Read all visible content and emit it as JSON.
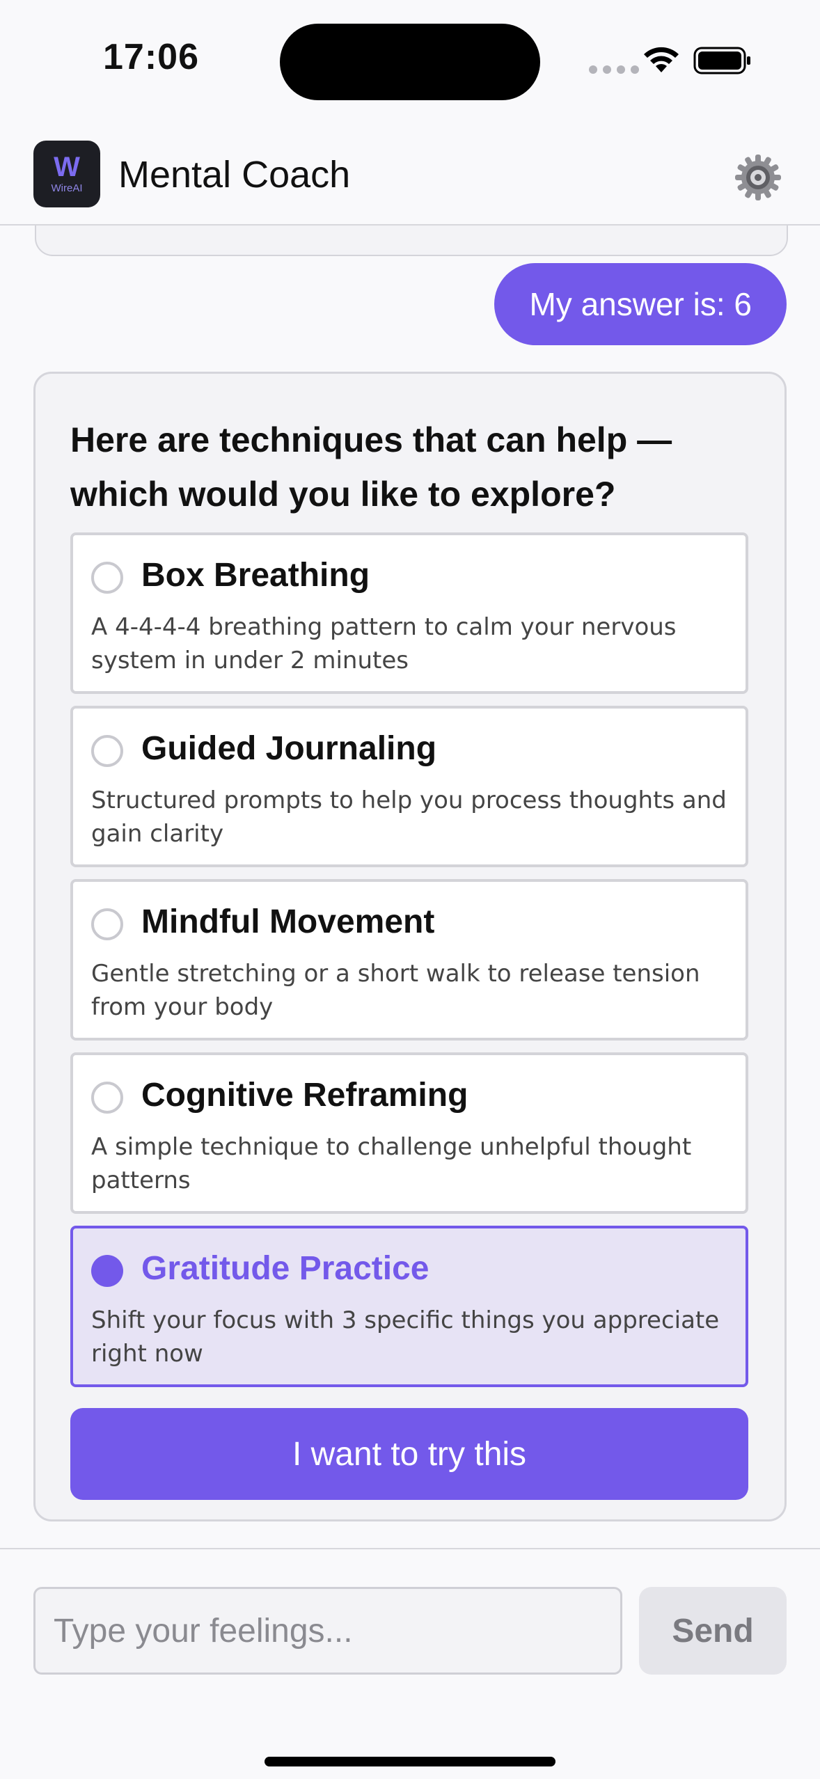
{
  "status_bar": {
    "time": "17:06"
  },
  "header": {
    "logo_mark": "W",
    "logo_text": "WireAI",
    "title": "Mental Coach",
    "settings_icon": "gear-icon"
  },
  "chat": {
    "user_message": "My answer is: 6",
    "bot_card": {
      "question": "Here are techniques that can help — which would you like to explore?",
      "options": [
        {
          "title": "Box Breathing",
          "description": "A 4-4-4-4 breathing pattern to calm your nervous system in under 2 minutes",
          "selected": false
        },
        {
          "title": "Guided Journaling",
          "description": "Structured prompts to help you process thoughts and gain clarity",
          "selected": false
        },
        {
          "title": "Mindful Movement",
          "description": "Gentle stretching or a short walk to release tension from your body",
          "selected": false
        },
        {
          "title": "Cognitive Reframing",
          "description": "A simple technique to challenge unhelpful thought patterns",
          "selected": false
        },
        {
          "title": "Gratitude Practice",
          "description": "Shift your focus with 3 specific things you appreciate right now",
          "selected": true
        }
      ],
      "submit_label": "I want to try this"
    }
  },
  "composer": {
    "placeholder": "Type your feelings...",
    "value": "",
    "send_label": "Send"
  },
  "colors": {
    "accent": "#7359ea",
    "selected_bg": "#e7e3f5"
  }
}
